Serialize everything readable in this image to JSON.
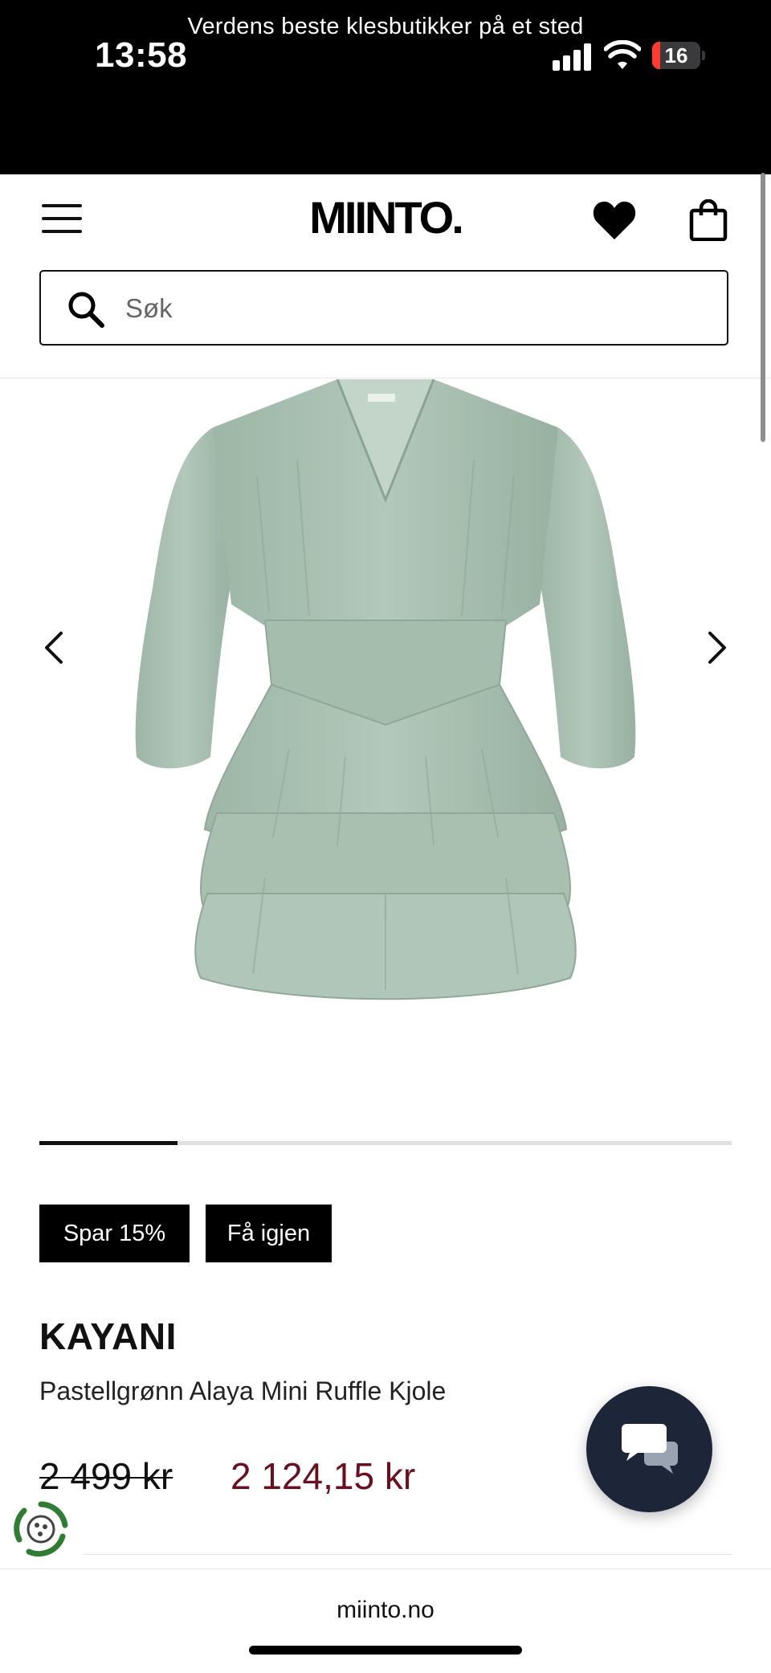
{
  "status_bar": {
    "time": "13:58",
    "battery_level": "16",
    "battery_fraction": 0.16,
    "icons": [
      "signal-icon",
      "wifi-icon",
      "battery-icon"
    ]
  },
  "promo": {
    "text": "Verdens beste klesbutikker på et sted"
  },
  "header": {
    "logo": "MIINTO.",
    "icons": [
      "menu-icon",
      "heart-icon",
      "bag-icon"
    ]
  },
  "search": {
    "placeholder": "Søk",
    "value": ""
  },
  "gallery": {
    "image_subject": "pastel green long-sleeve ruffle mini dress",
    "image_progress_fraction": 0.2
  },
  "product": {
    "badges": [
      "Spar 15%",
      "Få igjen"
    ],
    "brand": "KAYANI",
    "name": "Pastellgrønn Alaya Mini Ruffle Kjole",
    "price_original": "2 499 kr",
    "price_sale": "2 124,15 kr"
  },
  "browser": {
    "url": "miinto.no"
  },
  "colors": {
    "sale_price": "#6b0f1f",
    "chat_button": "#1c2638",
    "dress": "#a9c0b1",
    "eco_badge": "#2e7d32"
  }
}
